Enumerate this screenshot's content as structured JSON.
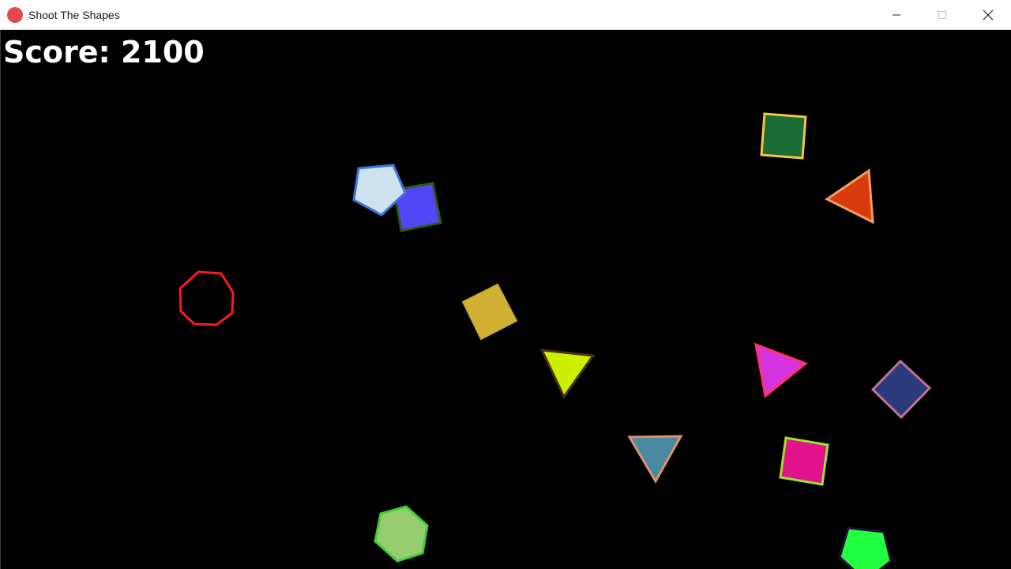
{
  "window": {
    "title": "Shoot The Shapes",
    "icon_color": "#e5484d",
    "controls": {
      "minimize": "minimize-icon",
      "maximize": "maximize-icon",
      "close": "close-icon"
    }
  },
  "hud": {
    "score_text": "Score: 2100"
  },
  "shapes": [
    {
      "kind": "square",
      "fill": "#1a6b35",
      "stroke": "#f2c744"
    },
    {
      "kind": "triangle",
      "fill": "#d93a0b",
      "stroke": "#f0a060"
    },
    {
      "kind": "pentagon",
      "fill": "#cfe3ef",
      "stroke": "#3a78d8"
    },
    {
      "kind": "square",
      "fill": "#5246f5",
      "stroke": "#2d5a1a"
    },
    {
      "kind": "octagon",
      "fill": "#000000",
      "stroke": "#ff1a1a"
    },
    {
      "kind": "square",
      "fill": "#d1b034",
      "stroke": "#c8a830"
    },
    {
      "kind": "triangle",
      "fill": "#ccf000",
      "stroke": "#4a3010"
    },
    {
      "kind": "triangle",
      "fill": "#d633e0",
      "stroke": "#ff3366"
    },
    {
      "kind": "square",
      "fill": "#2a3a7a",
      "stroke": "#c0709a"
    },
    {
      "kind": "triangle",
      "fill": "#4a8aa0",
      "stroke": "#e0906a"
    },
    {
      "kind": "square",
      "fill": "#e0138a",
      "stroke": "#a0e030"
    },
    {
      "kind": "hexagon",
      "fill": "#98cc70",
      "stroke": "#40d030"
    },
    {
      "kind": "pentagon",
      "fill": "#20ff40",
      "stroke": "#2a0a3a"
    }
  ]
}
